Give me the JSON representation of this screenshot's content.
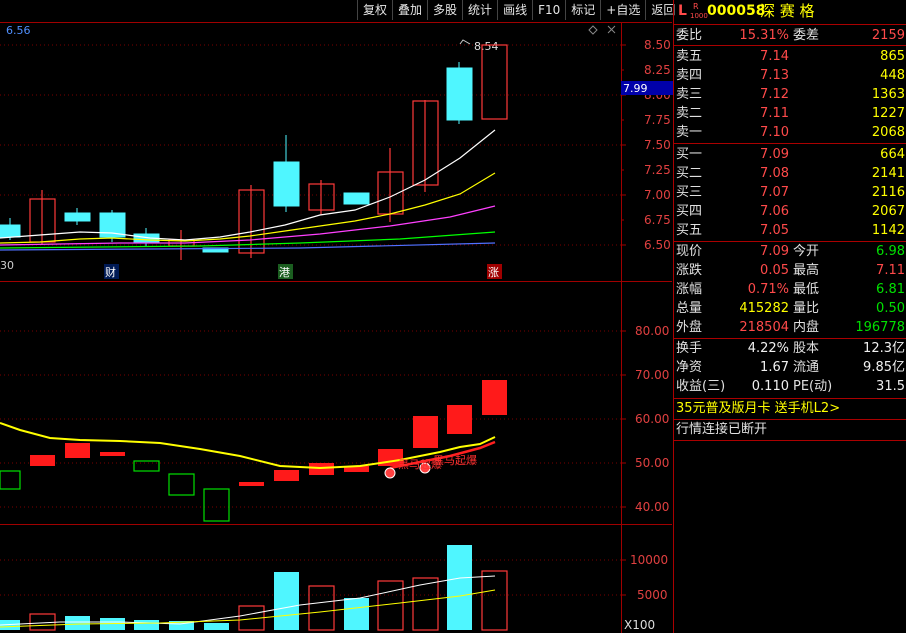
{
  "toolbar": {
    "items": [
      "复权",
      "叠加",
      "多股",
      "统计",
      "画线",
      "F10",
      "标记",
      "+自选",
      "返回"
    ]
  },
  "chart": {
    "price_corner_label": "6.56",
    "date_label": "30",
    "high_label": "8.54",
    "current_price_tag": "7.99",
    "event_marks": [
      "财",
      "港",
      "涨"
    ],
    "signal_label": "黑马起爆",
    "volume_multiplier": "X100",
    "price_axis": [
      "8.50",
      "8.25",
      "8.00",
      "7.75",
      "7.50",
      "7.25",
      "7.00",
      "6.75",
      "6.50"
    ],
    "indicator_axis": [
      "80.00",
      "70.00",
      "60.00",
      "50.00",
      "40.00"
    ],
    "volume_axis": [
      "10000",
      "5000"
    ],
    "colors": {
      "up": "#ff3a3a",
      "down": "#4ff6ff",
      "ma5": "#ffffff",
      "ma10": "#ffff00",
      "ma20": "#ff40ff",
      "ma60": "#00ff00",
      "grid": "#a00000"
    }
  },
  "quote": {
    "prefix_letter": "L",
    "prefix_r": "R",
    "prefix_lv": "1000",
    "code": "000058",
    "name": "深 赛 格",
    "weibi_label": "委比",
    "weibi_value": "15.31%",
    "weicha_label": "委差",
    "weicha_value": "2159",
    "sell": [
      {
        "label": "卖五",
        "price": "7.14",
        "vol": "865"
      },
      {
        "label": "卖四",
        "price": "7.13",
        "vol": "448"
      },
      {
        "label": "卖三",
        "price": "7.12",
        "vol": "1363"
      },
      {
        "label": "卖二",
        "price": "7.11",
        "vol": "1227"
      },
      {
        "label": "卖一",
        "price": "7.10",
        "vol": "2068"
      }
    ],
    "buy": [
      {
        "label": "买一",
        "price": "7.09",
        "vol": "664"
      },
      {
        "label": "买二",
        "price": "7.08",
        "vol": "2141"
      },
      {
        "label": "买三",
        "price": "7.07",
        "vol": "2116"
      },
      {
        "label": "买四",
        "price": "7.06",
        "vol": "2067"
      },
      {
        "label": "买五",
        "price": "7.05",
        "vol": "1142"
      }
    ],
    "stats1": [
      {
        "l1": "现价",
        "v1": "7.09",
        "c1": "red",
        "l2": "今开",
        "v2": "6.98",
        "c2": "green"
      },
      {
        "l1": "涨跌",
        "v1": "0.05",
        "c1": "red",
        "l2": "最高",
        "v2": "7.11",
        "c2": "red"
      },
      {
        "l1": "涨幅",
        "v1": "0.71%",
        "c1": "red",
        "l2": "最低",
        "v2": "6.81",
        "c2": "green"
      },
      {
        "l1": "总量",
        "v1": "415282",
        "c1": "yellow",
        "l2": "量比",
        "v2": "0.50",
        "c2": "green"
      },
      {
        "l1": "外盘",
        "v1": "218504",
        "c1": "red",
        "l2": "内盘",
        "v2": "196778",
        "c2": "green"
      }
    ],
    "stats2": [
      {
        "l1": "换手",
        "v1": "4.22%",
        "l2": "股本",
        "v2": "12.3亿"
      },
      {
        "l1": "净资",
        "v1": "1.67",
        "l2": "流通",
        "v2": "9.85亿"
      },
      {
        "l1": "收益(三)",
        "v1": "0.110",
        "l2": "PE(动)",
        "v2": "31.5"
      }
    ],
    "ad_text": "35元普及版月卡 送手机L2>",
    "status_text": "行情连接已断开"
  }
}
